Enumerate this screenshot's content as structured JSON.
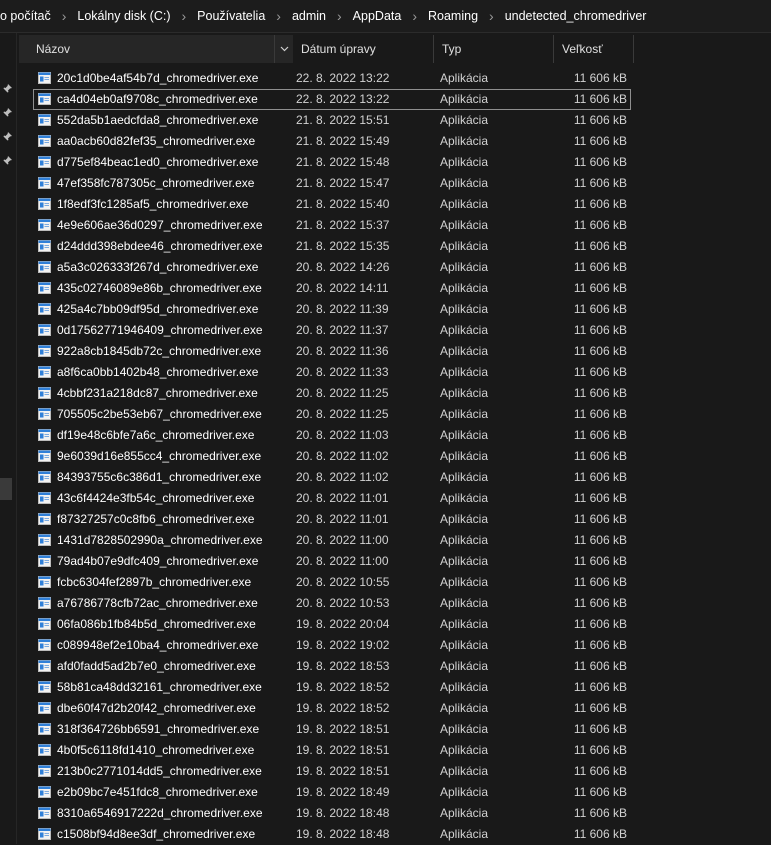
{
  "breadcrumb": [
    "o počítač",
    "Lokálny disk (C:)",
    "Používatelia",
    "admin",
    "AppData",
    "Roaming",
    "undetected_chromedriver"
  ],
  "columns": {
    "name": "Názov",
    "date": "Dátum úpravy",
    "type": "Typ",
    "size": "Veľkosť"
  },
  "colors": {
    "background": "#191919",
    "header_active": "#262626",
    "text": "#ffffff",
    "muted": "#d2d2d2",
    "exe_icon": "#2f7fd8"
  },
  "icons": {
    "file": "exe-window-icon",
    "pin": "pin-icon",
    "sort": "chevron-down-icon"
  },
  "selected_index": 1,
  "files": [
    {
      "name": "20c1d0be4af54b7d_chromedriver.exe",
      "date": "22. 8. 2022 13:22",
      "type": "Aplikácia",
      "size": "11 606 kB"
    },
    {
      "name": "ca4d04eb0af9708c_chromedriver.exe",
      "date": "22. 8. 2022 13:22",
      "type": "Aplikácia",
      "size": "11 606 kB"
    },
    {
      "name": "552da5b1aedcfda8_chromedriver.exe",
      "date": "21. 8. 2022 15:51",
      "type": "Aplikácia",
      "size": "11 606 kB"
    },
    {
      "name": "aa0acb60d82fef35_chromedriver.exe",
      "date": "21. 8. 2022 15:49",
      "type": "Aplikácia",
      "size": "11 606 kB"
    },
    {
      "name": "d775ef84beac1ed0_chromedriver.exe",
      "date": "21. 8. 2022 15:48",
      "type": "Aplikácia",
      "size": "11 606 kB"
    },
    {
      "name": "47ef358fc787305c_chromedriver.exe",
      "date": "21. 8. 2022 15:47",
      "type": "Aplikácia",
      "size": "11 606 kB"
    },
    {
      "name": "1f8edf3fc1285af5_chromedriver.exe",
      "date": "21. 8. 2022 15:40",
      "type": "Aplikácia",
      "size": "11 606 kB"
    },
    {
      "name": "4e9e606ae36d0297_chromedriver.exe",
      "date": "21. 8. 2022 15:37",
      "type": "Aplikácia",
      "size": "11 606 kB"
    },
    {
      "name": "d24ddd398ebdee46_chromedriver.exe",
      "date": "21. 8. 2022 15:35",
      "type": "Aplikácia",
      "size": "11 606 kB"
    },
    {
      "name": "a5a3c026333f267d_chromedriver.exe",
      "date": "20. 8. 2022 14:26",
      "type": "Aplikácia",
      "size": "11 606 kB"
    },
    {
      "name": "435c02746089e86b_chromedriver.exe",
      "date": "20. 8. 2022 14:11",
      "type": "Aplikácia",
      "size": "11 606 kB"
    },
    {
      "name": "425a4c7bb09df95d_chromedriver.exe",
      "date": "20. 8. 2022 11:39",
      "type": "Aplikácia",
      "size": "11 606 kB"
    },
    {
      "name": "0d17562771946409_chromedriver.exe",
      "date": "20. 8. 2022 11:37",
      "type": "Aplikácia",
      "size": "11 606 kB"
    },
    {
      "name": "922a8cb1845db72c_chromedriver.exe",
      "date": "20. 8. 2022 11:36",
      "type": "Aplikácia",
      "size": "11 606 kB"
    },
    {
      "name": "a8f6ca0bb1402b48_chromedriver.exe",
      "date": "20. 8. 2022 11:33",
      "type": "Aplikácia",
      "size": "11 606 kB"
    },
    {
      "name": "4cbbf231a218dc87_chromedriver.exe",
      "date": "20. 8. 2022 11:25",
      "type": "Aplikácia",
      "size": "11 606 kB"
    },
    {
      "name": "705505c2be53eb67_chromedriver.exe",
      "date": "20. 8. 2022 11:25",
      "type": "Aplikácia",
      "size": "11 606 kB"
    },
    {
      "name": "df19e48c6bfe7a6c_chromedriver.exe",
      "date": "20. 8. 2022 11:03",
      "type": "Aplikácia",
      "size": "11 606 kB"
    },
    {
      "name": "9e6039d16e855cc4_chromedriver.exe",
      "date": "20. 8. 2022 11:02",
      "type": "Aplikácia",
      "size": "11 606 kB"
    },
    {
      "name": "84393755c6c386d1_chromedriver.exe",
      "date": "20. 8. 2022 11:02",
      "type": "Aplikácia",
      "size": "11 606 kB"
    },
    {
      "name": "43c6f4424e3fb54c_chromedriver.exe",
      "date": "20. 8. 2022 11:01",
      "type": "Aplikácia",
      "size": "11 606 kB"
    },
    {
      "name": "f87327257c0c8fb6_chromedriver.exe",
      "date": "20. 8. 2022 11:01",
      "type": "Aplikácia",
      "size": "11 606 kB"
    },
    {
      "name": "1431d7828502990a_chromedriver.exe",
      "date": "20. 8. 2022 11:00",
      "type": "Aplikácia",
      "size": "11 606 kB"
    },
    {
      "name": "79ad4b07e9dfc409_chromedriver.exe",
      "date": "20. 8. 2022 11:00",
      "type": "Aplikácia",
      "size": "11 606 kB"
    },
    {
      "name": "fcbc6304fef2897b_chromedriver.exe",
      "date": "20. 8. 2022 10:55",
      "type": "Aplikácia",
      "size": "11 606 kB"
    },
    {
      "name": "a76786778cfb72ac_chromedriver.exe",
      "date": "20. 8. 2022 10:53",
      "type": "Aplikácia",
      "size": "11 606 kB"
    },
    {
      "name": "06fa086b1fb84b5d_chromedriver.exe",
      "date": "19. 8. 2022 20:04",
      "type": "Aplikácia",
      "size": "11 606 kB"
    },
    {
      "name": "c089948ef2e10ba4_chromedriver.exe",
      "date": "19. 8. 2022 19:02",
      "type": "Aplikácia",
      "size": "11 606 kB"
    },
    {
      "name": "afd0fadd5ad2b7e0_chromedriver.exe",
      "date": "19. 8. 2022 18:53",
      "type": "Aplikácia",
      "size": "11 606 kB"
    },
    {
      "name": "58b81ca48dd32161_chromedriver.exe",
      "date": "19. 8. 2022 18:52",
      "type": "Aplikácia",
      "size": "11 606 kB"
    },
    {
      "name": "dbe60f47d2b20f42_chromedriver.exe",
      "date": "19. 8. 2022 18:52",
      "type": "Aplikácia",
      "size": "11 606 kB"
    },
    {
      "name": "318f364726bb6591_chromedriver.exe",
      "date": "19. 8. 2022 18:51",
      "type": "Aplikácia",
      "size": "11 606 kB"
    },
    {
      "name": "4b0f5c6118fd1410_chromedriver.exe",
      "date": "19. 8. 2022 18:51",
      "type": "Aplikácia",
      "size": "11 606 kB"
    },
    {
      "name": "213b0c2771014dd5_chromedriver.exe",
      "date": "19. 8. 2022 18:51",
      "type": "Aplikácia",
      "size": "11 606 kB"
    },
    {
      "name": "e2b09bc7e451fdc8_chromedriver.exe",
      "date": "19. 8. 2022 18:49",
      "type": "Aplikácia",
      "size": "11 606 kB"
    },
    {
      "name": "8310a6546917222d_chromedriver.exe",
      "date": "19. 8. 2022 18:48",
      "type": "Aplikácia",
      "size": "11 606 kB"
    },
    {
      "name": "c1508bf94d8ee3df_chromedriver.exe",
      "date": "19. 8. 2022 18:48",
      "type": "Aplikácia",
      "size": "11 606 kB"
    }
  ]
}
